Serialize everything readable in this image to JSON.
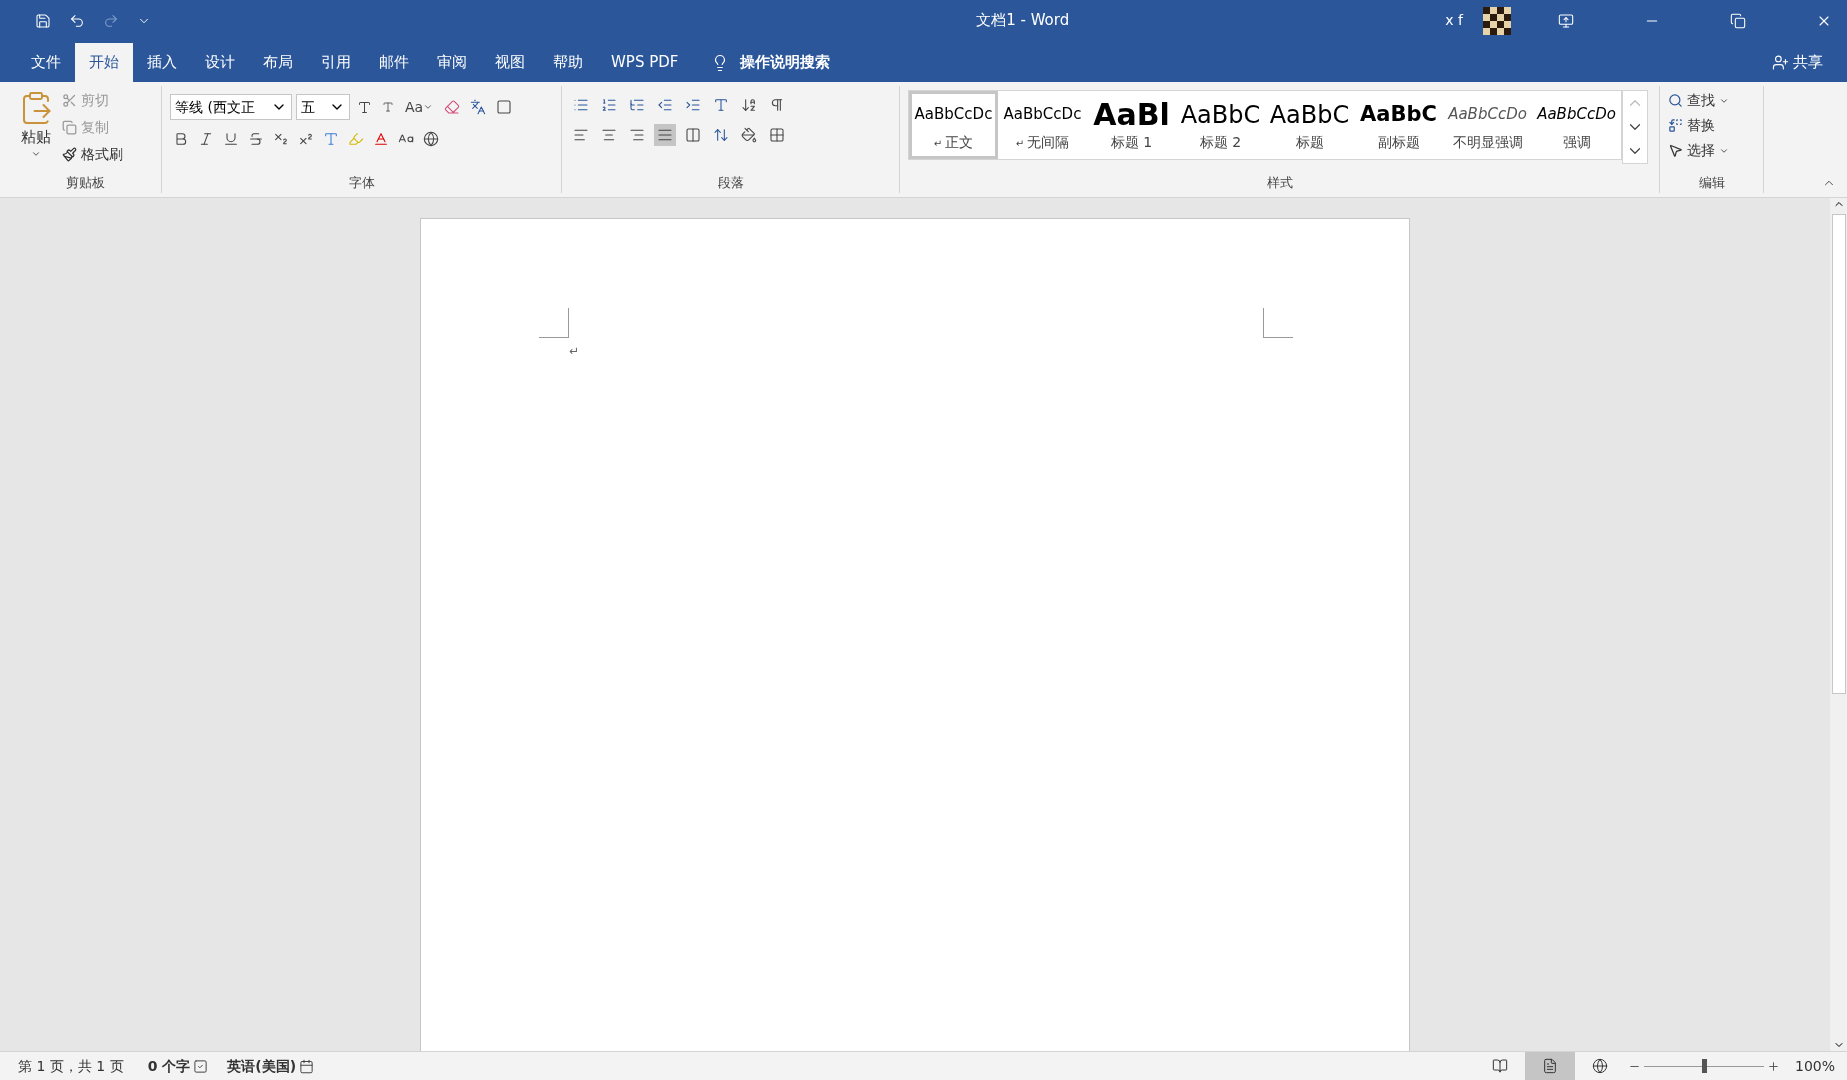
{
  "title_bar": {
    "title": "文档1 - Word",
    "user": "x f"
  },
  "tabs": [
    {
      "label": "文件",
      "selected": false
    },
    {
      "label": "开始",
      "selected": true
    },
    {
      "label": "插入",
      "selected": false
    },
    {
      "label": "设计",
      "selected": false
    },
    {
      "label": "布局",
      "selected": false
    },
    {
      "label": "引用",
      "selected": false
    },
    {
      "label": "邮件",
      "selected": false
    },
    {
      "label": "审阅",
      "selected": false
    },
    {
      "label": "视图",
      "selected": false
    },
    {
      "label": "帮助",
      "selected": false
    },
    {
      "label": "WPS PDF",
      "selected": false
    }
  ],
  "tell_me": "操作说明搜索",
  "share": "共享",
  "clipboard": {
    "label": "剪贴板",
    "paste": "粘贴",
    "cut": "剪切",
    "copy": "复制",
    "format_painter": "格式刷"
  },
  "font": {
    "label": "字体",
    "font_name": "等线 (西文正",
    "font_size": "五",
    "change_case": "Aa"
  },
  "paragraph": {
    "label": "段落"
  },
  "styles": {
    "label": "样式",
    "items": [
      {
        "preview": "AaBbCcDc",
        "label": "正文",
        "kind": "normal",
        "para_mark": true,
        "selected": true
      },
      {
        "preview": "AaBbCcDc",
        "label": "无间隔",
        "kind": "normal",
        "para_mark": true,
        "selected": false
      },
      {
        "preview": "AaBl",
        "label": "标题 1",
        "kind": "heading1",
        "para_mark": false,
        "selected": false
      },
      {
        "preview": "AaBbC",
        "label": "标题 2",
        "kind": "heading2",
        "para_mark": false,
        "selected": false
      },
      {
        "preview": "AaBbC",
        "label": "标题",
        "kind": "title",
        "para_mark": false,
        "selected": false
      },
      {
        "preview": "AaBbC",
        "label": "副标题",
        "kind": "subtitle",
        "para_mark": false,
        "selected": false
      },
      {
        "preview": "AaBbCcDo",
        "label": "不明显强调",
        "kind": "subtle",
        "para_mark": false,
        "selected": false
      },
      {
        "preview": "AaBbCcDo",
        "label": "强调",
        "kind": "emphasis",
        "para_mark": false,
        "selected": false
      }
    ]
  },
  "editing": {
    "label": "编辑",
    "find": "查找",
    "replace": "替换",
    "select": "选择"
  },
  "document": {
    "paragraph_mark": "↵"
  },
  "status_bar": {
    "page": "第 1 页，共 1 页",
    "words": "0 个字",
    "language": "英语(美国)",
    "zoom": "100%",
    "level": 0.5,
    "views": [
      {
        "kind": "read",
        "selected": false
      },
      {
        "kind": "print",
        "selected": true
      },
      {
        "kind": "web",
        "selected": false
      }
    ]
  }
}
